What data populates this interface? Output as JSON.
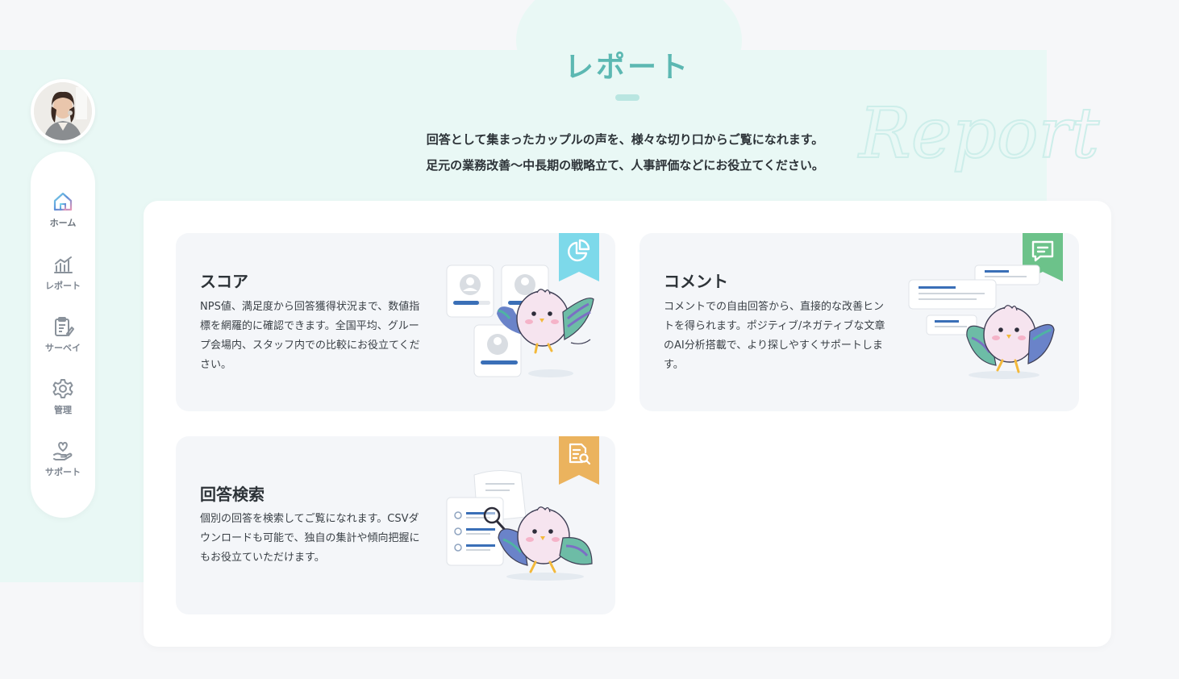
{
  "page": {
    "title": "レポート",
    "watermark": "Report",
    "description_line1": "回答として集まったカップルの声を、様々な切り口からご覧になれます。",
    "description_line2": "足元の業務改善～中長期の戦略立て、人事評価などにお役立てください。"
  },
  "sidebar": {
    "items": [
      {
        "label": "ホーム",
        "icon": "home-icon"
      },
      {
        "label": "レポート",
        "icon": "chart-icon"
      },
      {
        "label": "サーベイ",
        "icon": "clipboard-icon"
      },
      {
        "label": "管理",
        "icon": "gear-icon"
      },
      {
        "label": "サポート",
        "icon": "heart-hand-icon"
      }
    ]
  },
  "cards": [
    {
      "title": "スコア",
      "description": "NPS値、満足度から回答獲得状況まで、数値指標を網羅的に確認できます。全国平均、グループ会場内、スタッフ内での比較にお役立てください。",
      "icon": "pie-chart-icon",
      "color": "#7dd9ea"
    },
    {
      "title": "コメント",
      "description": "コメントでの自由回答から、直接的な改善ヒントを得られます。ポジティブ/ネガティブな文章のAI分析搭載で、より探しやすくサポートします。",
      "icon": "message-icon",
      "color": "#6cc28a"
    },
    {
      "title": "回答検索",
      "description": "個別の回答を検索してご覧になれます。CSVダウンロードも可能で、独自の集計や傾向把握にもお役立ていただけます。",
      "icon": "document-search-icon",
      "color": "#ebb35e"
    }
  ],
  "colors": {
    "accent": "#5cb8b2",
    "mint_bg": "#e9f8f5",
    "card_bg": "#f4f6f9"
  }
}
